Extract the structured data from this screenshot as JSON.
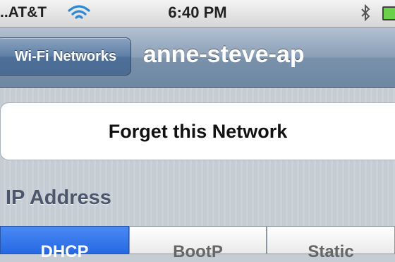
{
  "status_bar": {
    "carrier": "..AT&T",
    "time": "6:40 PM",
    "wifi_icon": "wifi-icon",
    "bluetooth_icon": "bluetooth-icon",
    "battery_color": "#6cd04a"
  },
  "nav_bar": {
    "back_label": "Wi-Fi Networks",
    "title": "anne-steve-ap"
  },
  "forget_label": "Forget this Network",
  "ip_section": {
    "header": "IP Address",
    "segments": [
      "DHCP",
      "BootP",
      "Static"
    ],
    "selected": "DHCP"
  },
  "colors": {
    "selected_segment": "#2668e3",
    "nav_bar": "#7a91ab"
  }
}
